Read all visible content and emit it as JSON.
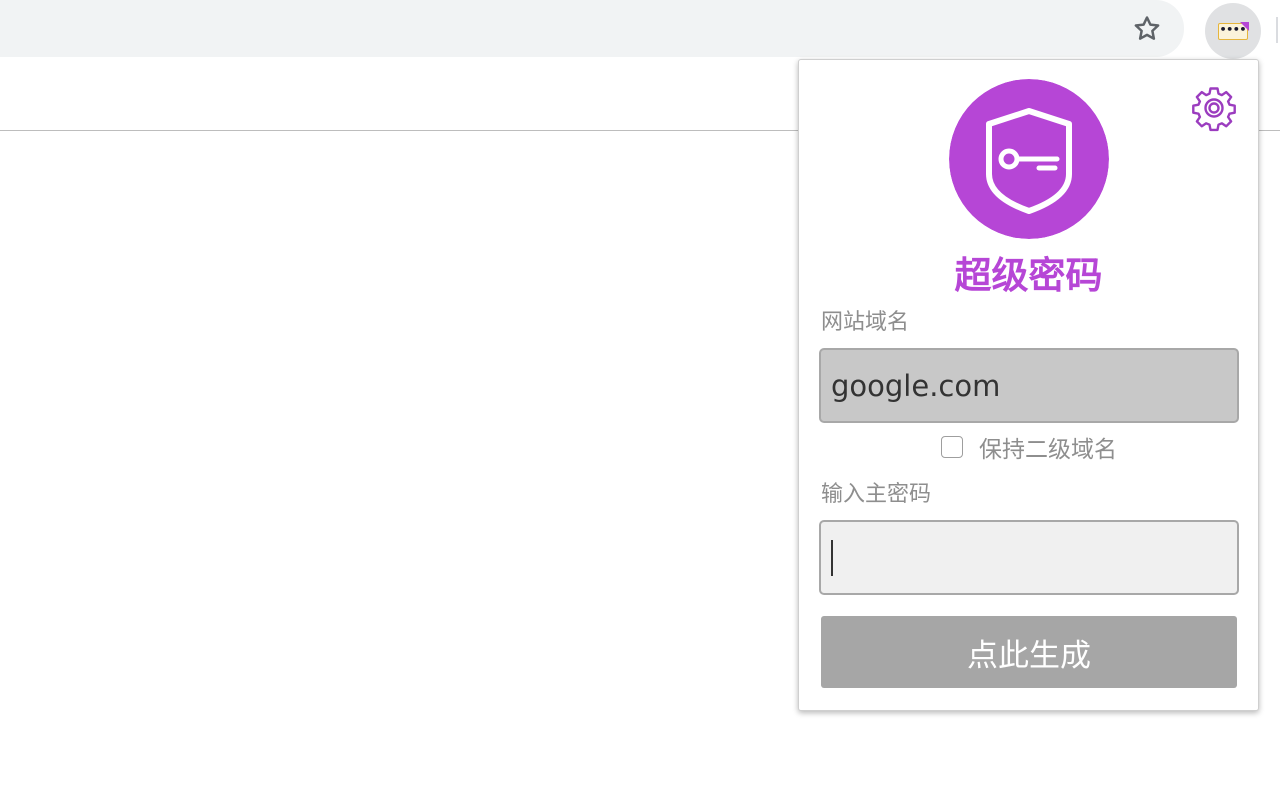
{
  "browser": {
    "bookmark_icon": "star-outline-icon",
    "extension_icon": "password-dots-icon",
    "extension_badge_dots": "••••"
  },
  "popup": {
    "settings_icon": "gear-icon",
    "logo_icon": "shield-key-icon",
    "title": "超级密码",
    "domain_label": "网站域名",
    "domain_value": "google.com",
    "keep_subdomain_label": "保持二级域名",
    "keep_subdomain_checked": false,
    "master_label": "输入主密码",
    "master_value": "",
    "generate_button": "点此生成"
  },
  "colors": {
    "accent": "#b646d6",
    "label_gray": "#8e8e8e",
    "button_gray": "#a6a6a6",
    "domain_input_bg": "#c8c8c8"
  }
}
